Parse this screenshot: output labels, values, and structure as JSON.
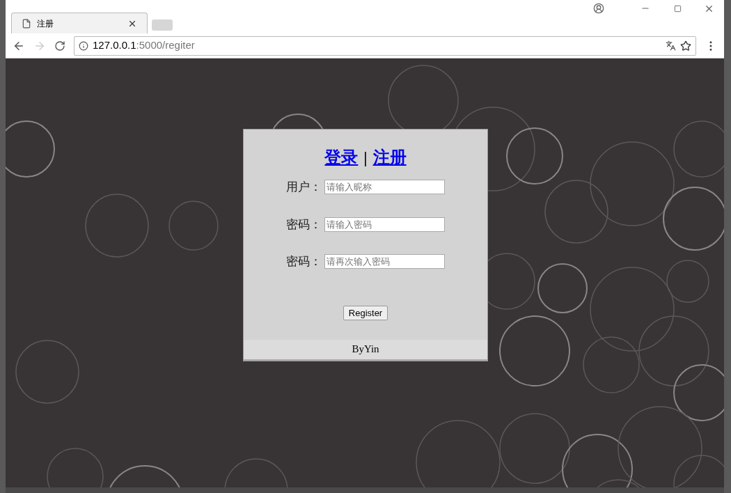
{
  "browser": {
    "tab": {
      "title": "注册"
    },
    "url": {
      "host": "127.0.0.1",
      "path": ":5000/regiter"
    }
  },
  "page": {
    "nav": [
      {
        "label": "登录"
      },
      {
        "label": "注册"
      }
    ],
    "separator": "|",
    "fields": [
      {
        "label": "用户：",
        "placeholder": "请输入昵称"
      },
      {
        "label": "密码：",
        "placeholder": "请输入密码"
      },
      {
        "label": "密码：",
        "placeholder": "请再次输入密码"
      }
    ],
    "button": "Register",
    "footer": "ByYin"
  }
}
